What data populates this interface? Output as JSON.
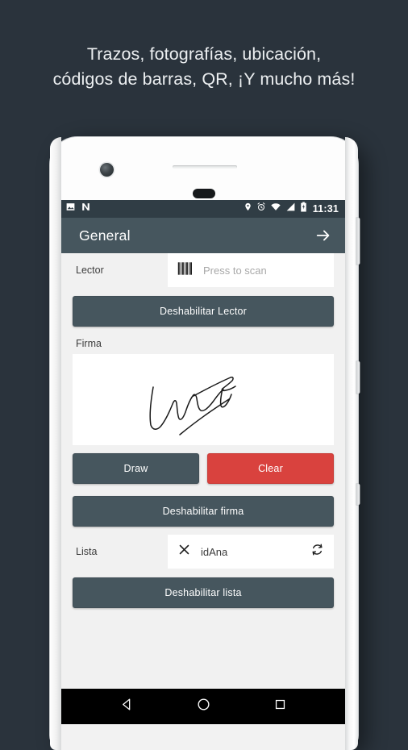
{
  "headline": {
    "line1": "Trazos, fotografías, ubicación,",
    "line2": "códigos de barras, QR, ¡Y mucho más!"
  },
  "colors": {
    "page_background": "#2a333c",
    "appbar": "#46565e",
    "button_dark": "#46565e",
    "button_red": "#d9423e",
    "statusbar": "#303d45",
    "content_background": "#f1f1f1",
    "navbar": "#000000",
    "headline_text": "#eceff1"
  },
  "phone": {
    "status_bar": {
      "left_icons": [
        "image-icon",
        "nfc-n-icon"
      ],
      "right_icons": [
        "location-pin-icon",
        "alarm-clock-icon",
        "wifi-icon",
        "signal-icon",
        "battery-charging-icon"
      ],
      "time": "11:31"
    },
    "app_bar": {
      "title": "General",
      "action_icon": "arrow-right-icon"
    },
    "content": {
      "lector": {
        "label": "Lector",
        "scan_icon": "barcode-icon",
        "placeholder": "Press to scan",
        "value": ""
      },
      "disable_lector_button": "Deshabilitar Lector",
      "firma": {
        "label": "Firma",
        "draw_button": "Draw",
        "clear_button": "Clear"
      },
      "disable_firma_button": "Deshabilitar firma",
      "lista": {
        "label": "Lista",
        "clear_icon": "close-x-icon",
        "value": "idAna",
        "refresh_icon": "sync-refresh-icon"
      },
      "disable_lista_button": "Deshabilitar lista"
    },
    "nav_bar": {
      "back_icon": "triangle-back-icon",
      "home_icon": "circle-home-icon",
      "recents_icon": "square-recents-icon"
    }
  }
}
